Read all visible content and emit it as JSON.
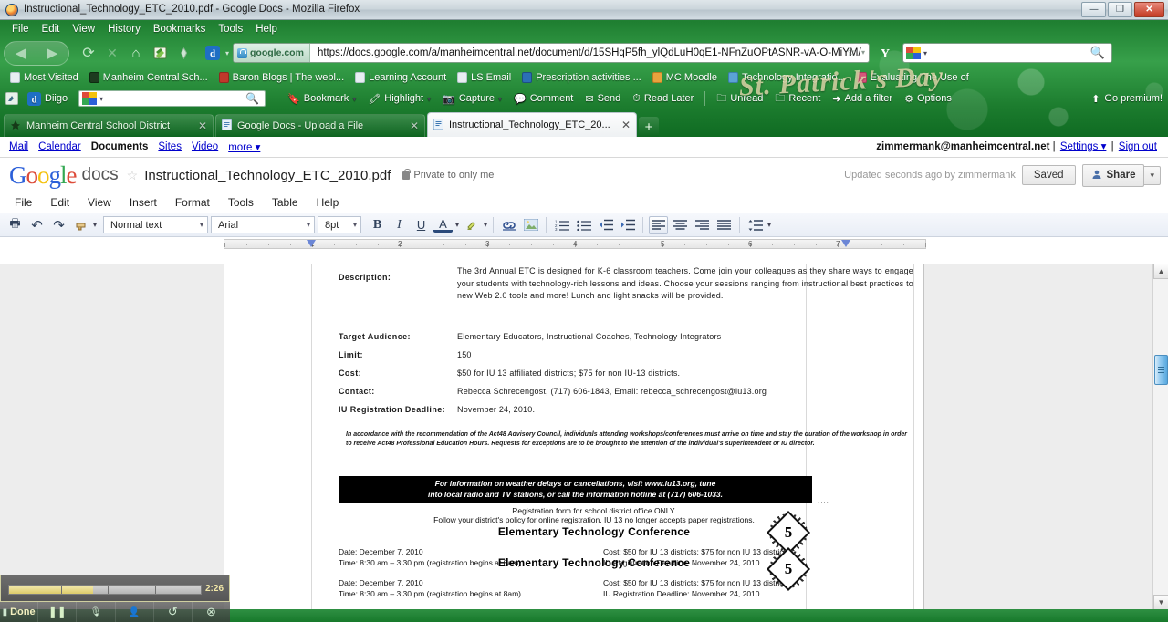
{
  "window": {
    "title": "Instructional_Technology_ETC_2010.pdf - Google Docs - Mozilla Firefox",
    "minimize": "—",
    "maximize": "❐",
    "close": "✕"
  },
  "menubar": {
    "items": [
      "File",
      "Edit",
      "View",
      "History",
      "Bookmarks",
      "Tools",
      "Help"
    ]
  },
  "navbar": {
    "back": "◀",
    "forward": "▶",
    "reload": "⟳",
    "stop": "✕",
    "home": "⌂",
    "identity_domain": "google.com",
    "url": "https://docs.google.com/a/manheimcentral.net/document/d/15SHqP5fh_ylQdLuH0qE1-NFnZuOPtASNR-vA-O-MiYM/",
    "bookmark_star": "☆",
    "search_placeholder": "Google",
    "search_value": ""
  },
  "bookmarks": [
    "Most Visited",
    "Manheim Central Sch...",
    "Baron Blogs | The webl...",
    "Learning Account",
    "LS Email",
    "Prescription activities ...",
    "MC Moodle",
    "Technology Integratio...",
    "Evaluating The Use of"
  ],
  "diigo": {
    "brand": "Diigo",
    "search_value": "",
    "buttons": [
      "Bookmark",
      "Highlight",
      "Capture",
      "Comment",
      "Send",
      "Read Later",
      "Unread",
      "Recent",
      "Add a filter",
      "Options"
    ],
    "premium": "Go premium!"
  },
  "persona": {
    "text": "St. Patrick's Day"
  },
  "tabs": [
    {
      "label": "Manheim Central School District",
      "active": false,
      "close": "✕"
    },
    {
      "label": "Google Docs - Upload a File",
      "active": false,
      "close": "✕"
    },
    {
      "label": "Instructional_Technology_ETC_20...",
      "active": true,
      "close": "✕"
    }
  ],
  "newtab": "+",
  "google_bar": {
    "links": [
      "Mail",
      "Calendar",
      "Documents",
      "Sites",
      "Video",
      "more ▾"
    ],
    "current": "Documents",
    "account": "zimmermank@manheimcentral.net",
    "settings": "Settings ▾",
    "signout": "Sign out",
    "sep": "|"
  },
  "doc_header": {
    "logo_google": "Google",
    "logo_docs": "docs",
    "star": "☆",
    "title": "Instructional_Technology_ETC_2010.pdf",
    "privacy": "Private to only me",
    "updated": "Updated seconds ago by zimmermank",
    "saved": "Saved",
    "share": "Share",
    "share_caret": "▾"
  },
  "doc_menu": {
    "items": [
      "File",
      "Edit",
      "View",
      "Insert",
      "Format",
      "Tools",
      "Table",
      "Help"
    ]
  },
  "toolbar": {
    "print": "🖶",
    "undo": "↶",
    "redo": "↷",
    "paint": "🖌",
    "paint_caret": "▾",
    "style": "Normal text",
    "font": "Arial",
    "size": "8pt",
    "bold": "B",
    "italic": "I",
    "underline": "U",
    "text_color": "A",
    "text_color_caret": "▾",
    "highlight": "✎",
    "highlight_caret": "▾",
    "link": "🔗",
    "image": "🖼",
    "numbered_list": "≣",
    "bulleted_list": "☰",
    "outdent": "⇤",
    "indent": "⇥",
    "align_left": "≡",
    "align_center": "≡",
    "align_right": "≡",
    "align_justify": "≡",
    "line_spacing": "↕",
    "line_spacing_caret": "▾"
  },
  "ruler": {
    "numbers": [
      "1",
      "2",
      "3",
      "4",
      "5",
      "6",
      "7"
    ]
  },
  "document": {
    "rows": [
      {
        "label": "Description:",
        "value": "The 3rd Annual ETC is designed for K-6 classroom teachers. Come join your colleagues as they share ways to engage your students with technology-rich lessons and ideas. Choose your sessions ranging from instructional best practices to new Web 2.0 tools and more! Lunch and light snacks will be provided."
      },
      {
        "label": "Target Audience:",
        "value": "Elementary Educators, Instructional Coaches, Technology Integrators"
      },
      {
        "label": "Limit:",
        "value": "150"
      },
      {
        "label": "Cost:",
        "value": "$50 for IU 13 affiliated districts; $75 for non IU-13 districts."
      },
      {
        "label": "Contact:",
        "value": "Rebecca Schrecengost, (717) 606-1843, Email: rebecca_schrecengost@iu13.org"
      },
      {
        "label": "IU Registration Deadline:",
        "value": "November 24, 2010."
      }
    ],
    "act48": "In accordance with the recommendation of the Act48 Advisory Council, individuals attending workshops/conferences must arrive on time and stay the duration of the workshop in order to receive Act48 Professional Education Hours. Requests for exceptions are to be brought to the attention of the individual's superintendent or IU director.",
    "weather_banner_line1": "For information on weather delays or cancellations, visit www.iu13.org, tune",
    "weather_banner_line2": "into local radio and TV stations, or call the information hotline at (717) 606-1033.",
    "dots": "....",
    "registration_line1": "Registration form for school district office ONLY.",
    "registration_line2": "Follow your district's policy for online registration. IU 13 no longer accepts paper registrations.",
    "conference_title": "Elementary Technology Conference",
    "badge_number": "5",
    "entry": {
      "date": "Date: December 7, 2010",
      "time": "Time: 8:30 am – 3:30 pm  (registration begins at 8am)",
      "cost": "Cost: $50 for IU 13 districts; $75 for non IU 13 districts",
      "deadline": "IU Registration Deadline:  November 24, 2010"
    }
  },
  "scrollbar": {
    "up": "▲",
    "down": "▼"
  },
  "recorder": {
    "time": "2:26",
    "done": "Done",
    "pause": "❚❚",
    "buttons": [
      "record-audio",
      "record-webcam",
      "undo",
      "cancel"
    ]
  }
}
